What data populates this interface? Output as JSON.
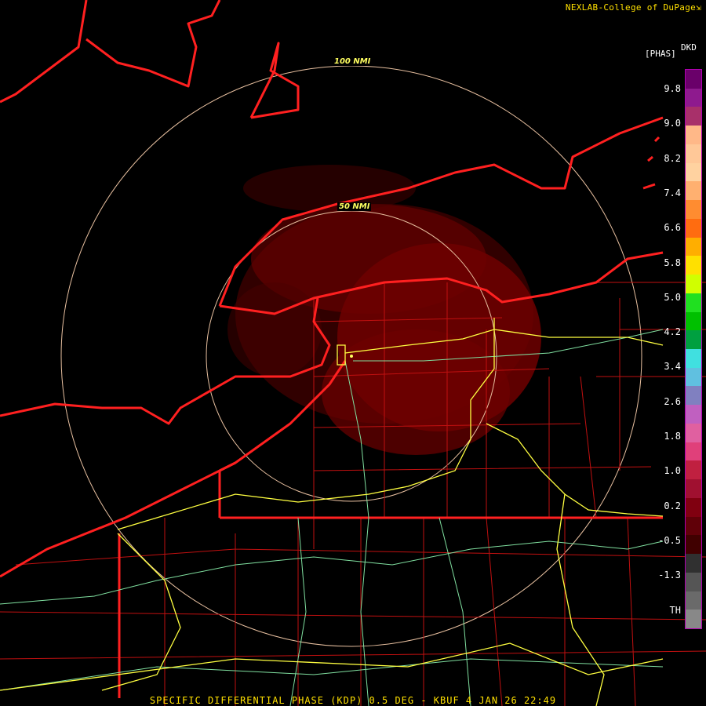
{
  "header": {
    "credit": "NEXLAB-College of DuPage",
    "credit_icon": "resize-corner-icon"
  },
  "legend": {
    "product": "DKD",
    "units": "[PHAS]",
    "ticks": [
      "9.8",
      "9.0",
      "8.2",
      "7.4",
      "6.6",
      "5.8",
      "5.0",
      "4.2",
      "3.4",
      "2.6",
      "1.8",
      "1.0",
      "0.2",
      "-0.5",
      "-1.3",
      "TH"
    ],
    "colors": [
      "#6a006a",
      "#8e1a8e",
      "#a8306a",
      "#ffb888",
      "#ffc898",
      "#ffd2a0",
      "#ffb070",
      "#ff8c30",
      "#ff6c10",
      "#ffae00",
      "#ffe000",
      "#d0ff00",
      "#20e020",
      "#00c000",
      "#00a040",
      "#40e0e0",
      "#60c0e0",
      "#8080c0",
      "#c060c0",
      "#e060a0",
      "#e0407a",
      "#c02040",
      "#a01030",
      "#800010",
      "#600008",
      "#400000",
      "#303030",
      "#555555",
      "#6a6a6a",
      "#888888"
    ]
  },
  "rings": [
    {
      "label": "100 NMI"
    },
    {
      "label": "50 NMI"
    }
  ],
  "footer": {
    "caption": "SPECIFIC DIFFERENTIAL PHASE (KDP) 0.5 DEG - KBUF 4 JAN 26 22:49"
  },
  "colors": {
    "border": "#ff2020",
    "county": "#c01010",
    "highway": "#ffff40",
    "road": "#80e0a0",
    "ring": "#e8c0a0",
    "echo": "#6e0000"
  }
}
